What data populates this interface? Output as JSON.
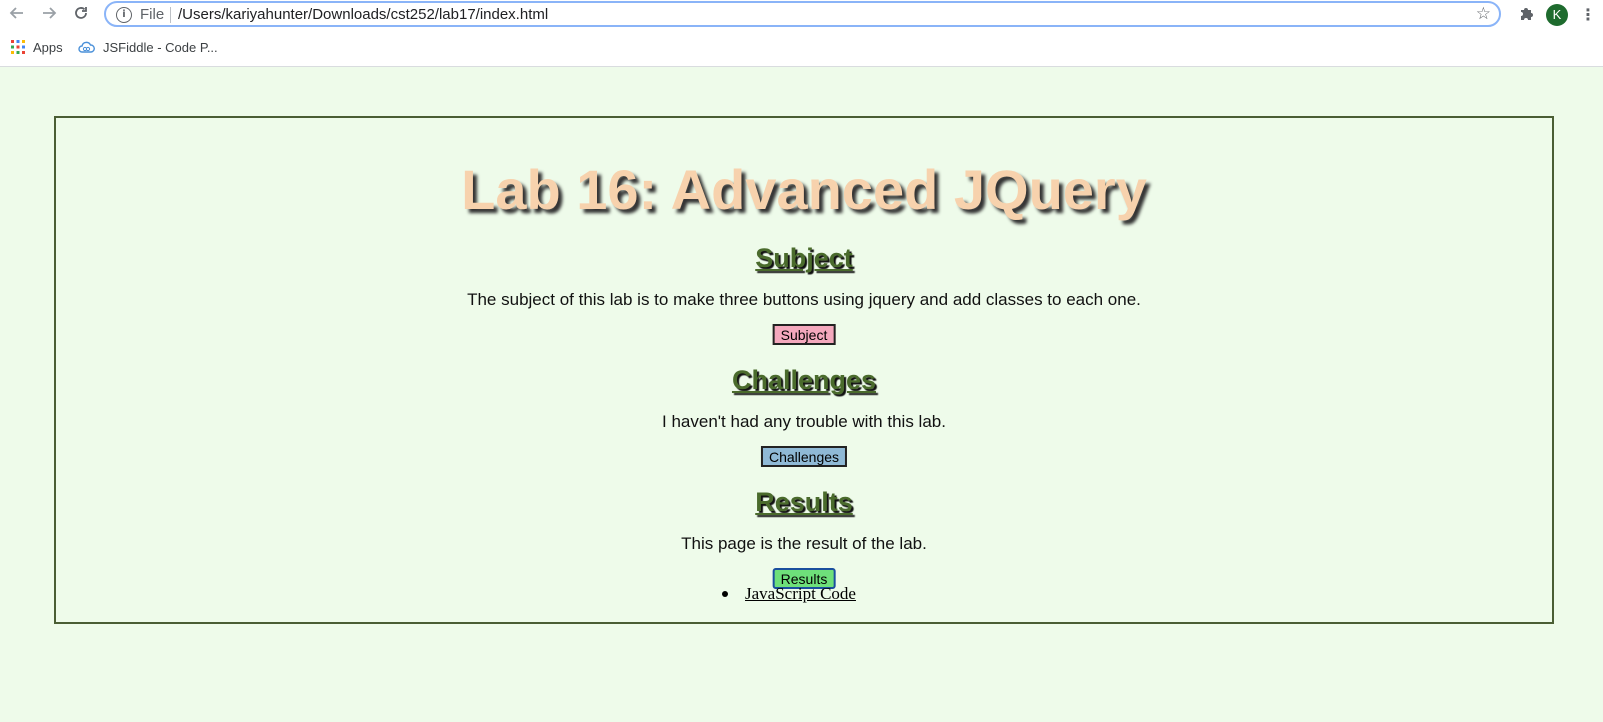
{
  "browser": {
    "scheme_label": "File",
    "url": "/Users/kariyahunter/Downloads/cst252/lab17/index.html",
    "avatar_initial": "K",
    "bookmarks": [
      {
        "label": "Apps",
        "icon": "apps-grid-icon"
      },
      {
        "label": "JSFiddle - Code P...",
        "icon": "jsfiddle-cloud-icon"
      }
    ]
  },
  "page": {
    "title": "Lab 16: Advanced JQuery",
    "sections": [
      {
        "heading": "Subject",
        "text": "The subject of this lab is to make three buttons using jquery and add classes to each one.",
        "button": "Subject"
      },
      {
        "heading": "Challenges",
        "text": "I haven't had any trouble with this lab.",
        "button": "Challenges"
      },
      {
        "heading": "Results",
        "text": "This page is the result of the lab.",
        "button": "Results"
      }
    ],
    "links": [
      {
        "label": "JavaScript Code"
      }
    ]
  },
  "colors": {
    "page_background": "#eefbea",
    "border": "#4a5e34",
    "title": "#f7d2ad",
    "heading": "#4a6b2c",
    "subject_button": "#f4a8bd",
    "challenges_button": "#8fb9d6",
    "results_button": "#6ee07a"
  }
}
